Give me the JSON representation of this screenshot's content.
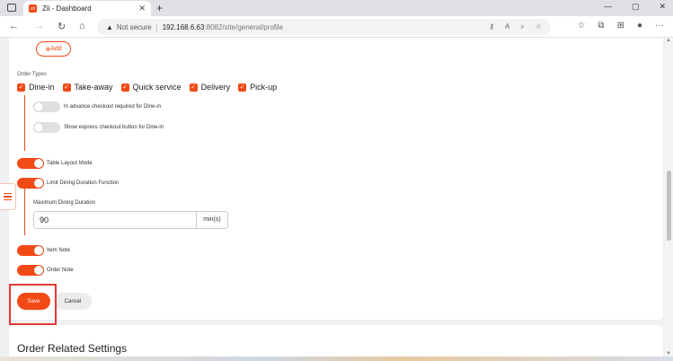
{
  "browser": {
    "tab_title": "Zii - Dashboard",
    "tab_favicon": "zii",
    "url_warning": "Not secure",
    "url_host": "192.168.6.63",
    "url_path": ":8082/site/general/profile",
    "accent": "#f24a16"
  },
  "form": {
    "add_label": "Add",
    "order_types_label": "Order Types",
    "order_types": [
      {
        "label": "Dine-in",
        "checked": true
      },
      {
        "label": "Take-away",
        "checked": true
      },
      {
        "label": "Quick service",
        "checked": true
      },
      {
        "label": "Delivery",
        "checked": true
      },
      {
        "label": "Pick-up",
        "checked": true
      }
    ],
    "toggles": {
      "advance_checkout": {
        "label": "In advance checkout required for Dine-in",
        "on": false
      },
      "express_checkout": {
        "label": "Show express checkout button for Dine-in",
        "on": false
      },
      "table_layout": {
        "label": "Table Layout Mode",
        "on": true
      },
      "limit_dining": {
        "label": "Limit Dining Duration Function",
        "on": true
      },
      "item_note": {
        "label": "Item Note",
        "on": true
      },
      "order_note": {
        "label": "Order Note",
        "on": true
      }
    },
    "max_duration_label": "Maximum Dining Duration",
    "max_duration_value": "90",
    "max_duration_unit": "min(s)",
    "save_label": "Save",
    "cancel_label": "Cancel"
  },
  "next_section": {
    "title": "Order Related Settings"
  }
}
